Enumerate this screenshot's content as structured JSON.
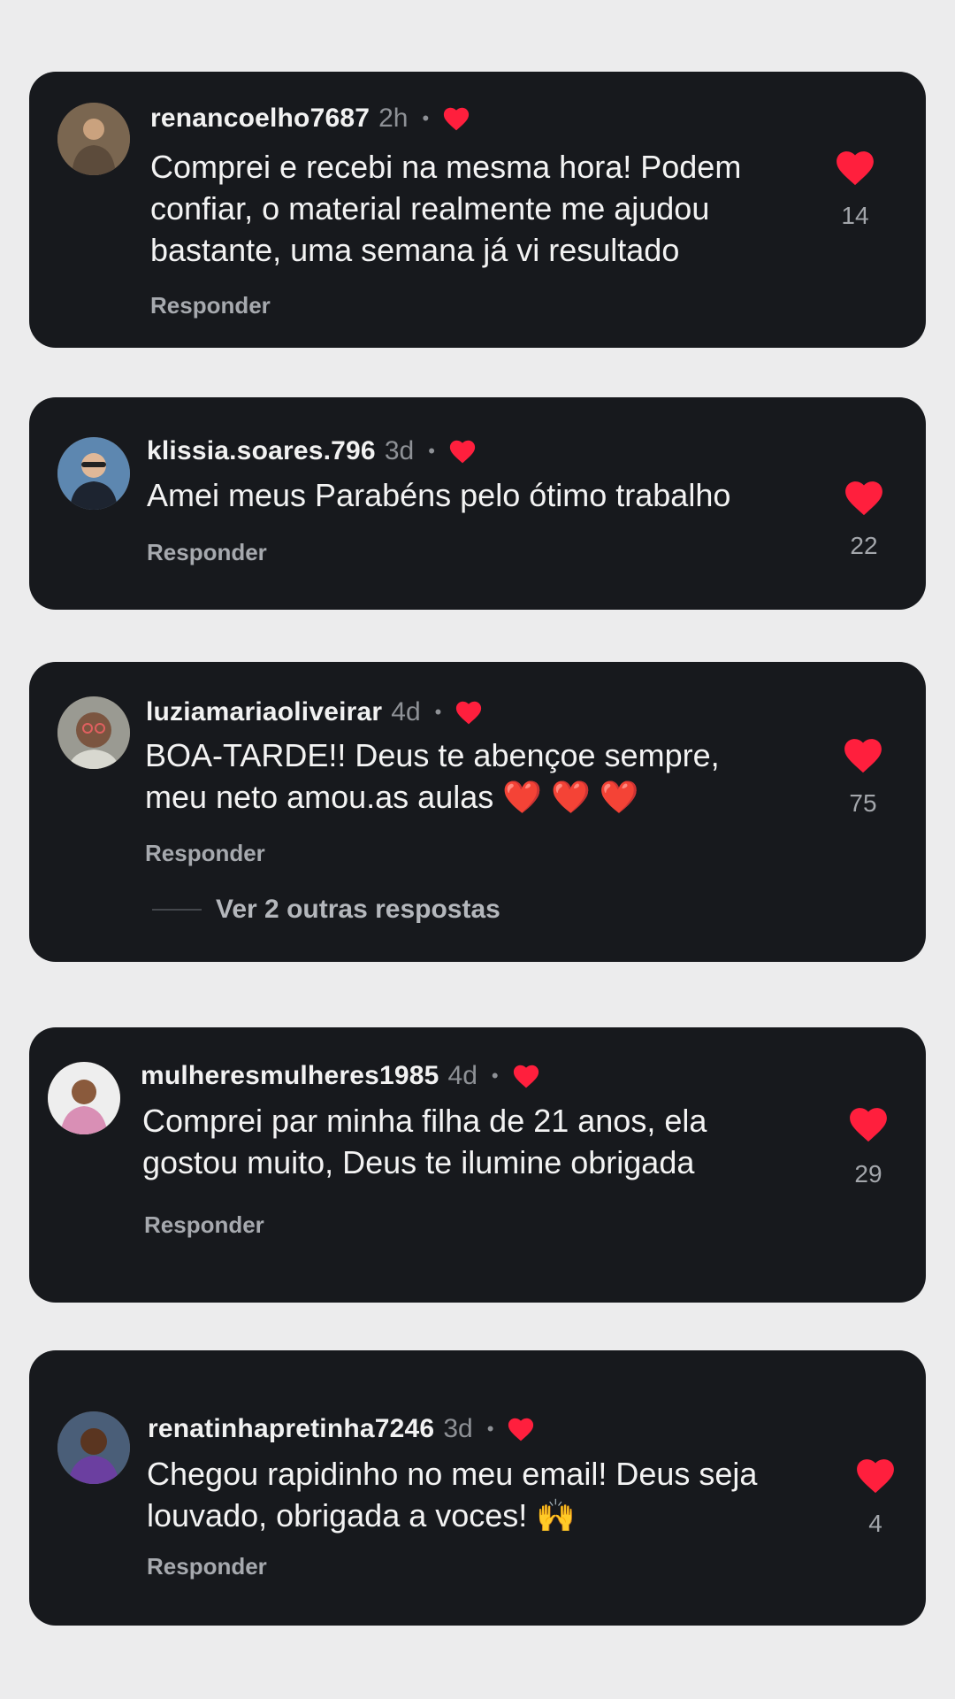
{
  "comments": [
    {
      "username": "renancoelho7687",
      "time": "2h",
      "text": "Comprei e recebi na mesma hora! Podem\nconfiar, o material realmente me ajudou\nbastante, uma semana já vi resultado",
      "reply_label": "Responder",
      "likes": "14"
    },
    {
      "username": "klissia.soares.796",
      "time": "3d",
      "text": "Amei  meus Parabéns pelo ótimo trabalho",
      "reply_label": "Responder",
      "likes": "22"
    },
    {
      "username": "luziamariaoliveirar",
      "time": "4d",
      "text": "BOA-TARDE!! Deus te abençoe sempre,\nmeu neto amou.as aulas ❤️ ❤️ ❤️",
      "reply_label": "Responder",
      "likes": "75",
      "more_replies": "Ver 2 outras respostas"
    },
    {
      "username": "mulheresmulheres1985",
      "time": "4d",
      "text": "Comprei par minha filha de 21 anos, ela\ngostou muito, Deus te ilumine obrigada",
      "reply_label": "Responder",
      "likes": "29"
    },
    {
      "username": "renatinhapretinha7246",
      "time": "3d",
      "text": "Chegou rapidinho no meu email! Deus seja\nlouvado, obrigada a voces! 🙌",
      "reply_label": "Responder",
      "likes": "4"
    }
  ],
  "separator": "•",
  "colors": {
    "background": "#ececed",
    "card": "#17191d",
    "heart": "#ff1f3d",
    "username": "#f2f2f2",
    "muted": "#8e9196"
  }
}
